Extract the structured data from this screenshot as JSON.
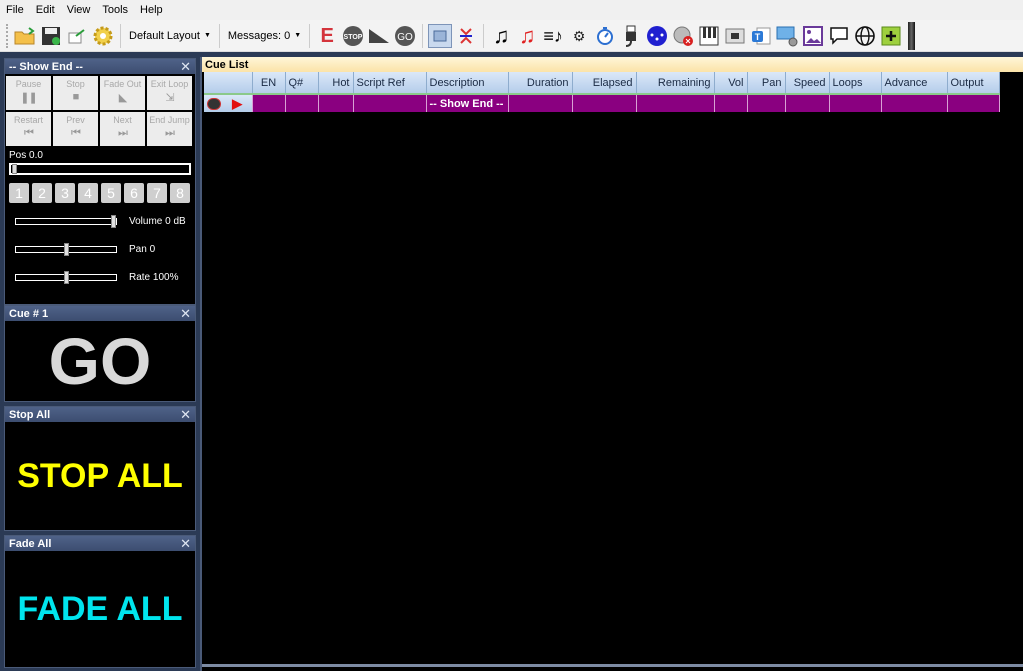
{
  "menu": [
    "File",
    "Edit",
    "View",
    "Tools",
    "Help"
  ],
  "toolbar": {
    "icons_left": [
      "open-folder-icon",
      "save-icon",
      "export-icon",
      "settings-gear-icon"
    ],
    "layout_dropdown": "Default Layout",
    "messages_dropdown": "Messages: 0",
    "cue_icons": [
      "edit-e-icon",
      "stop-icon",
      "fade-ramp-icon",
      "go-icon"
    ],
    "view_icons": [
      "panel-view-icon",
      "collapse-icon"
    ],
    "media_icons": [
      "audio-cue-icon",
      "audio-cue-red-icon",
      "playlist-icon",
      "gears-icon",
      "timer-icon",
      "usb-icon",
      "dmx-icon",
      "speaker-mute-icon",
      "midi-piano-icon",
      "network-icon",
      "text-icon",
      "display-settings-icon",
      "image-icon",
      "comment-icon",
      "globe-icon",
      "add-icon"
    ]
  },
  "colors": {
    "cue_row": "#8a0080",
    "go_text": "#d8d8d8",
    "stop_all_text": "#ffff00",
    "fade_all_text": "#00e5ee"
  },
  "show_panel": {
    "title": "-- Show End --",
    "buttons": [
      {
        "label": "Pause",
        "glyph": "❚❚"
      },
      {
        "label": "Stop",
        "glyph": "■"
      },
      {
        "label": "Fade Out",
        "glyph": "◣"
      },
      {
        "label": "Exit Loop",
        "glyph": "⇲"
      },
      {
        "label": "Restart",
        "glyph": "⏮"
      },
      {
        "label": "Prev",
        "glyph": "⏮"
      },
      {
        "label": "Next",
        "glyph": "⏭"
      },
      {
        "label": "End Jump",
        "glyph": "⏭"
      }
    ],
    "pos_label": "Pos 0.0",
    "pos_value": 0.0,
    "channels": [
      "1",
      "2",
      "3",
      "4",
      "5",
      "6",
      "7",
      "8"
    ],
    "volume_label": "Volume 0 dB",
    "volume_fraction": 1.0,
    "pan_label": "Pan 0",
    "pan_fraction": 0.5,
    "rate_label": "Rate 100%",
    "rate_fraction": 0.5
  },
  "cue_panel": {
    "title": "Cue # 1",
    "label": "GO"
  },
  "stop_panel": {
    "title": "Stop All",
    "label": "STOP ALL"
  },
  "fade_panel": {
    "title": "Fade All",
    "label": "FADE ALL"
  },
  "close_glyph": "✕",
  "cue_list": {
    "title": "Cue List",
    "columns": [
      "",
      "EN",
      "Q#",
      "Hot",
      "Script Ref",
      "Description",
      "Duration",
      "Elapsed",
      "Remaining",
      "Vol",
      "Pan",
      "Speed",
      "Loops",
      "Advance",
      "Output"
    ],
    "rows": [
      {
        "cells": [
          "",
          "",
          "",
          "",
          "-- Show End --",
          "",
          "",
          "",
          "",
          "",
          "",
          "",
          "",
          ""
        ]
      }
    ]
  }
}
